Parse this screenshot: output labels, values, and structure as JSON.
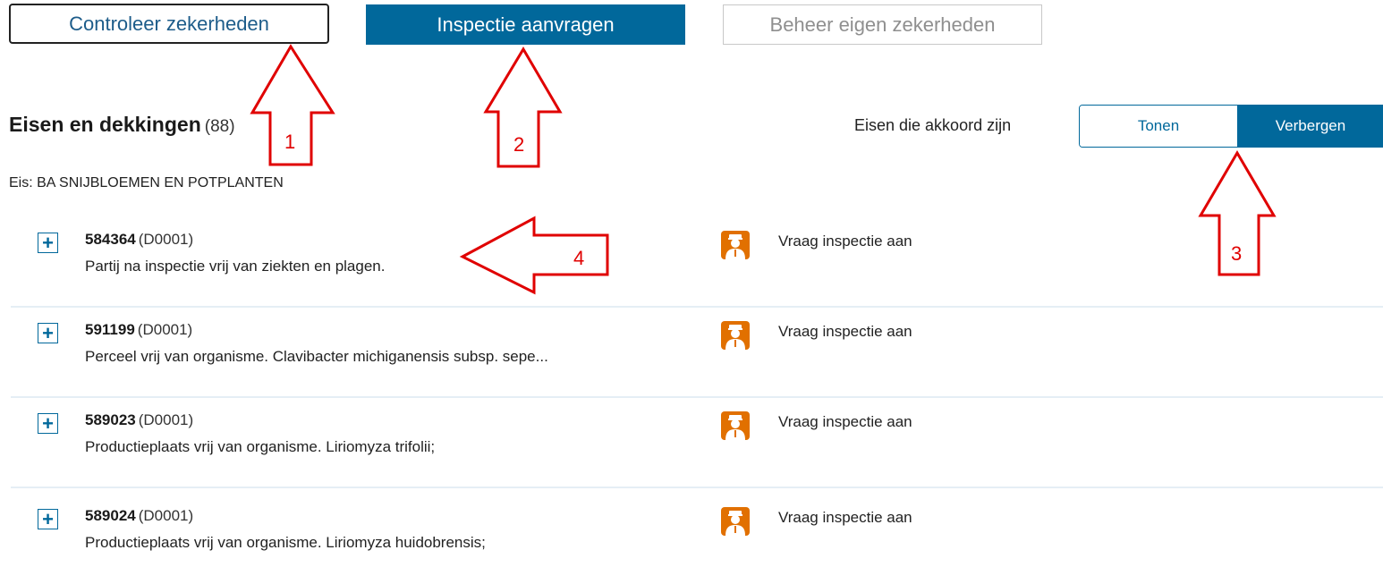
{
  "buttons": {
    "check": "Controleer zekerheden",
    "request": "Inspectie aanvragen",
    "manage": "Beheer eigen zekerheden"
  },
  "section": {
    "title": "Eisen en dekkingen",
    "count": "(88)"
  },
  "toggle": {
    "label": "Eisen die akkoord zijn",
    "show": "Tonen",
    "hide": "Verbergen",
    "selected": "Verbergen"
  },
  "eis_label": "Eis: BA SNIJBLOEMEN EN POTPLANTEN",
  "requirements": [
    {
      "code": "584364",
      "suffix": "(D0001)",
      "description": "Partij na inspectie vrij van ziekten en plagen.",
      "action": "Vraag inspectie aan"
    },
    {
      "code": "591199",
      "suffix": "(D0001)",
      "description": "Perceel vrij van organisme. Clavibacter michiganensis subsp. sepe...",
      "action": "Vraag inspectie aan"
    },
    {
      "code": "589023",
      "suffix": "(D0001)",
      "description": "Productieplaats vrij van organisme. Liriomyza trifolii;",
      "action": "Vraag inspectie aan"
    },
    {
      "code": "589024",
      "suffix": "(D0001)",
      "description": "Productieplaats vrij van organisme. Liriomyza huidobrensis;",
      "action": "Vraag inspectie aan"
    }
  ],
  "annotations": [
    "1",
    "2",
    "3",
    "4"
  ],
  "colors": {
    "primary": "#01689b",
    "inspection_icon": "#e17000",
    "annotation": "#e00000"
  }
}
